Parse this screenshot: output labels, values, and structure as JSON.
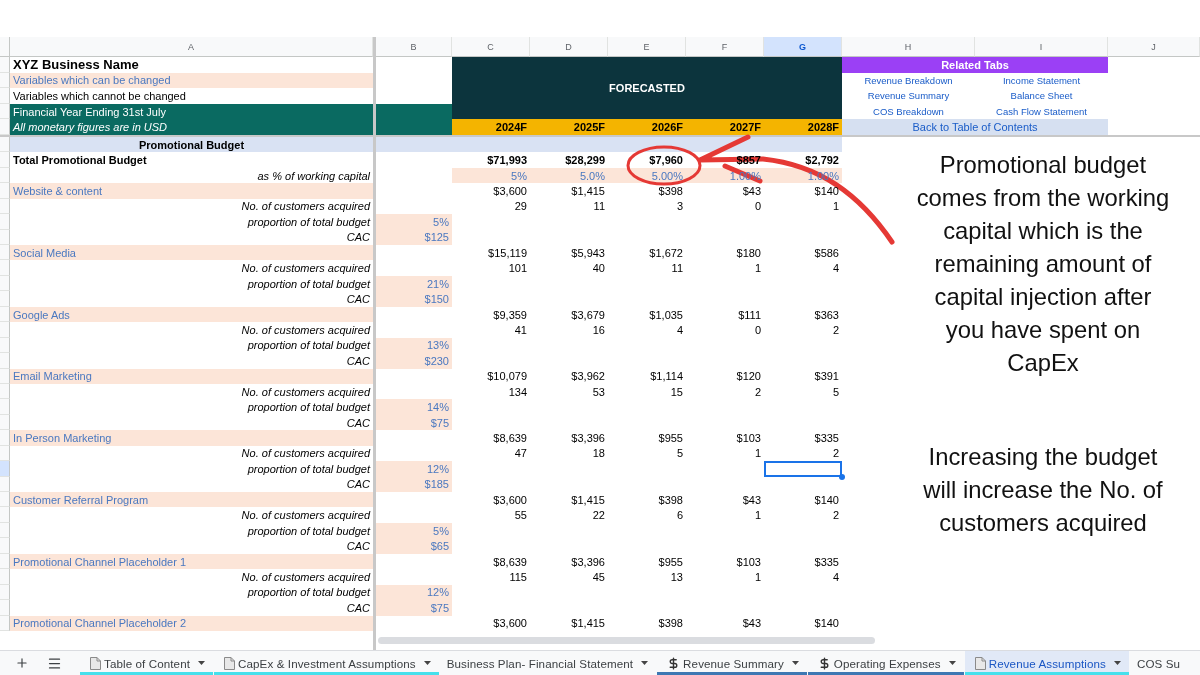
{
  "column_headers": [
    {
      "label": "A",
      "selected": false
    },
    {
      "label": "B",
      "selected": false
    },
    {
      "label": "C",
      "selected": false
    },
    {
      "label": "D",
      "selected": false
    },
    {
      "label": "E",
      "selected": false
    },
    {
      "label": "F",
      "selected": false
    },
    {
      "label": "G",
      "selected": true
    },
    {
      "label": "H",
      "selected": false
    },
    {
      "label": "I",
      "selected": false
    },
    {
      "label": "J",
      "selected": false
    }
  ],
  "header_block": {
    "title": "XYZ Business Name",
    "legend": [
      {
        "text": "Variables which can be changed",
        "variable": true
      },
      {
        "text": "Variables which cannot be changed",
        "variable": false
      }
    ],
    "banner": [
      {
        "text": "Financial Year Ending 31st July",
        "italic": false
      },
      {
        "text": "All monetary figures are in USD",
        "italic": true
      }
    ]
  },
  "forecast": {
    "label": "FORECASTED",
    "years": [
      "2024F",
      "2025F",
      "2026F",
      "2027F",
      "2028F"
    ]
  },
  "related_tabs": {
    "title": "Related Tabs",
    "links": [
      "Revenue Breakdown",
      "Income Statement",
      "Revenue Summary",
      "Balance Sheet",
      "COS Breakdown",
      "Cash Flow Statement"
    ],
    "back_link": "Back to Table of Contents"
  },
  "rows": [
    {
      "kind": "section",
      "label": "Promotional Budget",
      "selected": false
    },
    {
      "kind": "total",
      "label": "Total Promotional Budget",
      "values": [
        "$71,993",
        "$28,299",
        "$7,960",
        "$857",
        "$2,792"
      ],
      "selected": false
    },
    {
      "kind": "ratio",
      "label": "as % of working capital",
      "variable": true,
      "values": [
        "5%",
        "5.0%",
        "5.00%",
        "1.00%",
        "1.00%"
      ],
      "selected": false
    },
    {
      "kind": "channel",
      "label": "Website & content",
      "variable": true,
      "values": [
        "$3,600",
        "$1,415",
        "$398",
        "$43",
        "$140"
      ],
      "selected": false
    },
    {
      "kind": "metric",
      "label": "No. of customers acquired",
      "values": [
        "29",
        "11",
        "3",
        "0",
        "1"
      ],
      "selected": false
    },
    {
      "kind": "metric",
      "label": "proportion of total budget",
      "input": {
        "text": "5%",
        "variable": true
      },
      "selected": false
    },
    {
      "kind": "metric",
      "label": "CAC",
      "input": {
        "text": "$125",
        "variable": true
      },
      "selected": false
    },
    {
      "kind": "channel",
      "label": "Social Media",
      "variable": true,
      "values": [
        "$15,119",
        "$5,943",
        "$1,672",
        "$180",
        "$586"
      ],
      "selected": false
    },
    {
      "kind": "metric",
      "label": "No. of customers acquired",
      "values": [
        "101",
        "40",
        "11",
        "1",
        "4"
      ],
      "selected": false
    },
    {
      "kind": "metric",
      "label": "proportion of total budget",
      "input": {
        "text": "21%",
        "variable": true
      },
      "selected": false
    },
    {
      "kind": "metric",
      "label": "CAC",
      "input": {
        "text": "$150",
        "variable": true
      },
      "selected": false
    },
    {
      "kind": "channel",
      "label": "Google Ads",
      "variable": true,
      "values": [
        "$9,359",
        "$3,679",
        "$1,035",
        "$111",
        "$363"
      ],
      "selected": false
    },
    {
      "kind": "metric",
      "label": "No. of customers acquired",
      "values": [
        "41",
        "16",
        "4",
        "0",
        "2"
      ],
      "selected": false
    },
    {
      "kind": "metric",
      "label": "proportion of total budget",
      "input": {
        "text": "13%",
        "variable": true
      },
      "selected": false
    },
    {
      "kind": "metric",
      "label": "CAC",
      "input": {
        "text": "$230",
        "variable": true
      },
      "selected": false
    },
    {
      "kind": "channel",
      "label": "Email Marketing",
      "variable": true,
      "values": [
        "$10,079",
        "$3,962",
        "$1,114",
        "$120",
        "$391"
      ],
      "selected": false
    },
    {
      "kind": "metric",
      "label": "No. of customers acquired",
      "values": [
        "134",
        "53",
        "15",
        "2",
        "5"
      ],
      "selected": false
    },
    {
      "kind": "metric",
      "label": "proportion of total budget",
      "input": {
        "text": "14%",
        "variable": true
      },
      "selected": false
    },
    {
      "kind": "metric",
      "label": "CAC",
      "input": {
        "text": "$75",
        "variable": true
      },
      "selected": false
    },
    {
      "kind": "channel",
      "label": "In Person Marketing",
      "variable": true,
      "values": [
        "$8,639",
        "$3,396",
        "$955",
        "$103",
        "$335"
      ],
      "selected": false
    },
    {
      "kind": "metric",
      "label": "No. of customers acquired",
      "values": [
        "47",
        "18",
        "5",
        "1",
        "2"
      ],
      "selected": false
    },
    {
      "kind": "metric",
      "label": "proportion of total budget",
      "input": {
        "text": "12%",
        "variable": true
      },
      "selected": true
    },
    {
      "kind": "metric",
      "label": "CAC",
      "input": {
        "text": "$185",
        "variable": true
      },
      "selected": false
    },
    {
      "kind": "channel",
      "label": "Customer Referral Program",
      "variable": true,
      "values": [
        "$3,600",
        "$1,415",
        "$398",
        "$43",
        "$140"
      ],
      "selected": false
    },
    {
      "kind": "metric",
      "label": "No. of customers acquired",
      "values": [
        "55",
        "22",
        "6",
        "1",
        "2"
      ],
      "selected": false
    },
    {
      "kind": "metric",
      "label": "proportion of total budget",
      "input": {
        "text": "5%",
        "variable": true
      },
      "selected": false
    },
    {
      "kind": "metric",
      "label": "CAC",
      "input": {
        "text": "$65",
        "variable": true
      },
      "selected": false
    },
    {
      "kind": "channel",
      "label": "Promotional Channel Placeholder 1",
      "variable": true,
      "values": [
        "$8,639",
        "$3,396",
        "$955",
        "$103",
        "$335"
      ],
      "selected": false
    },
    {
      "kind": "metric",
      "label": "No. of customers acquired",
      "values": [
        "115",
        "45",
        "13",
        "1",
        "4"
      ],
      "selected": false
    },
    {
      "kind": "metric",
      "label": "proportion of total budget",
      "input": {
        "text": "12%",
        "variable": true
      },
      "selected": false
    },
    {
      "kind": "metric",
      "label": "CAC",
      "input": {
        "text": "$75",
        "variable": true
      },
      "selected": false
    },
    {
      "kind": "channel",
      "label": "Promotional Channel Placeholder 2",
      "variable": true,
      "values": [
        "$3,600",
        "$1,415",
        "$398",
        "$43",
        "$140"
      ],
      "selected": false
    }
  ],
  "notes": [
    "Promotional budget comes from the working capital which is the remaining amount of capital injection after you have spent on CapEx",
    "Increasing the budget will increase the No. of customers acquired"
  ],
  "sheet_tabs": [
    {
      "label": "Table of Content",
      "kind": "document",
      "selected": false,
      "color": "#46e0ec"
    },
    {
      "label": "CapEx & Investment Assumptions",
      "kind": "document",
      "selected": false,
      "color": "#46e0ec"
    },
    {
      "label": "Business Plan- Financial Statement",
      "kind": "plain",
      "selected": false
    },
    {
      "label": "Revenue Summary",
      "kind": "currency",
      "selected": false,
      "color": "#3d78b3"
    },
    {
      "label": "Operating Expenses",
      "kind": "currency",
      "selected": false,
      "color": "#3d78b3"
    },
    {
      "label": "Revenue Assumptions",
      "kind": "document",
      "selected": true,
      "color": "#46e0ec"
    },
    {
      "label": "COS Su",
      "kind": "plain",
      "selected": false
    }
  ]
}
